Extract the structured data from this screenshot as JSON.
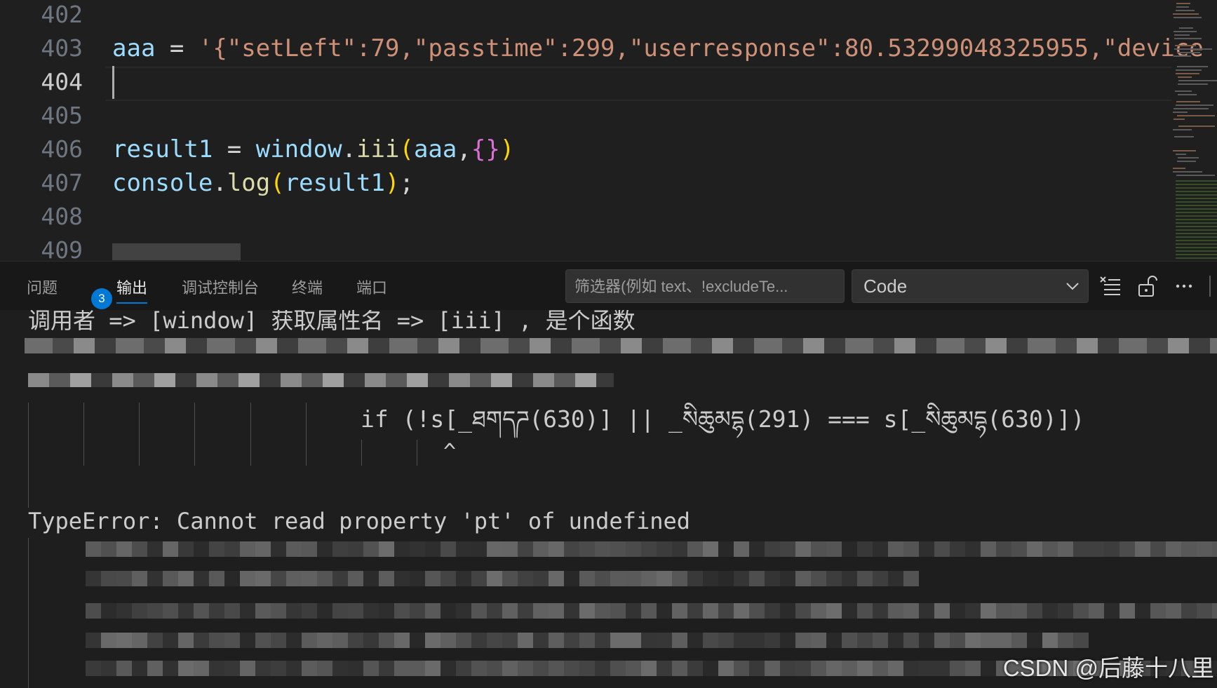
{
  "editor": {
    "line_numbers": [
      "402",
      "403",
      "404",
      "405",
      "406",
      "407",
      "408",
      "409"
    ],
    "active_line": "404",
    "line403": {
      "var": "aaa",
      "op": " = ",
      "string": "'{\"setLeft\":79,\"passtime\":299,\"userresponse\":80.53299048325955,\"device"
    },
    "line406": {
      "var": "result1",
      "op": " = ",
      "obj": "window",
      "dot": ".",
      "method": "iii",
      "open": "(",
      "arg": "aaa",
      "comma": ",",
      "braces": "{}",
      "close": ")"
    },
    "line407": {
      "obj": "console",
      "dot": ".",
      "method": "log",
      "open": "(",
      "arg": "result1",
      "close": ")",
      "semi": ";"
    }
  },
  "panel": {
    "tabs": [
      {
        "label": "问题",
        "badge": "3"
      },
      {
        "label": "输出"
      },
      {
        "label": "调试控制台"
      },
      {
        "label": "终端"
      },
      {
        "label": "端口"
      }
    ],
    "active_tab": "输出",
    "filter_placeholder": "筛选器(例如 text、!excludeTe...",
    "channel_selected": "Code",
    "icons": [
      "clear-output-icon",
      "lock-scroll-icon",
      "more-actions-icon",
      "chevron-down-icon"
    ]
  },
  "output": {
    "line1": "调用者 => [window] 获取属性名 => [iii] , 是个函数",
    "code_line": "if (!s[_ཐགདཌ(630)] || _སིཆུམདྷ(291) === s[_སིཆུམདྷ(630)])",
    "caret": "^",
    "error": "TypeError: Cannot read property 'pt' of undefined"
  },
  "watermark": "CSDN @后藤十八里",
  "colors": {
    "editor_bg": "#1f1f1f",
    "panel_bg": "#181818",
    "accent": "#0078d4",
    "string": "#ce9178",
    "variable": "#9cdcfe",
    "function": "#dcdcaa"
  }
}
